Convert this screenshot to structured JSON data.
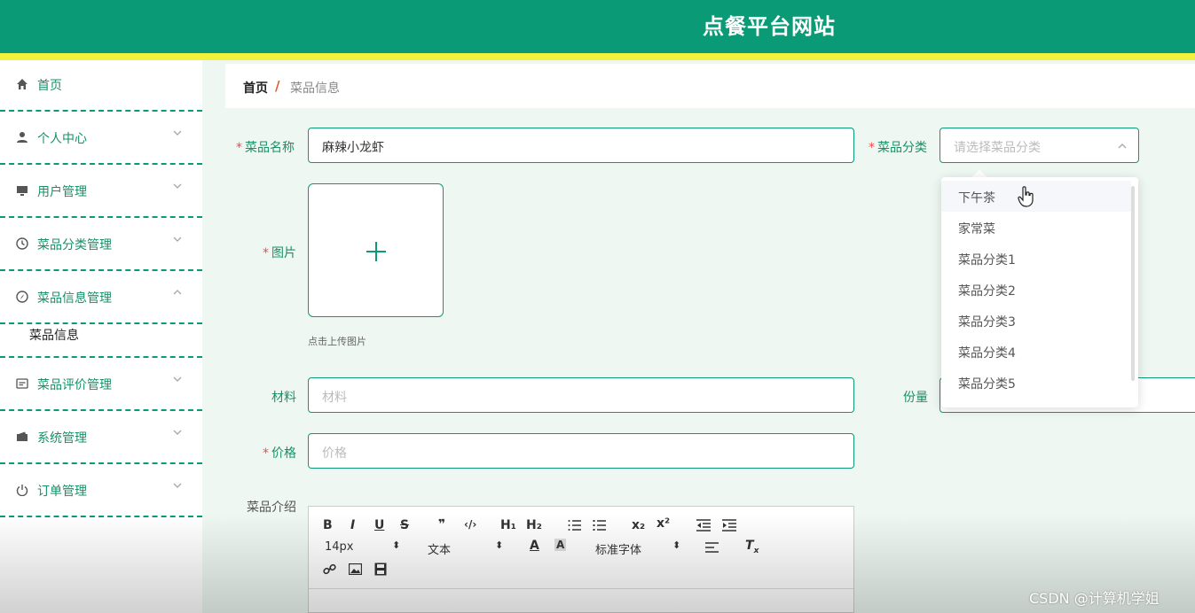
{
  "header": {
    "title": "点餐平台网站"
  },
  "sidebar": {
    "items": [
      {
        "label": "首页",
        "icon": "home-icon"
      },
      {
        "label": "个人中心",
        "icon": "user-icon"
      },
      {
        "label": "用户管理",
        "icon": "monitor-icon"
      },
      {
        "label": "菜品分类管理",
        "icon": "clock-icon"
      },
      {
        "label": "菜品信息管理",
        "icon": "compass-icon"
      },
      {
        "label": "菜品评价管理",
        "icon": "comment-icon"
      },
      {
        "label": "系统管理",
        "icon": "wallet-icon"
      },
      {
        "label": "订单管理",
        "icon": "power-icon"
      }
    ],
    "submenu": {
      "label": "菜品信息"
    }
  },
  "breadcrumb": {
    "home": "首页",
    "separator": "/",
    "current": "菜品信息"
  },
  "form": {
    "name": {
      "label": "菜品名称",
      "value": "麻辣小龙虾"
    },
    "category": {
      "label": "菜品分类",
      "placeholder": "请选择菜品分类"
    },
    "image": {
      "label": "图片",
      "hint": "点击上传图片"
    },
    "material": {
      "label": "材料",
      "placeholder": "材料"
    },
    "portion": {
      "label": "份量"
    },
    "price": {
      "label": "价格",
      "placeholder": "价格"
    },
    "intro": {
      "label": "菜品介绍"
    },
    "required_mark": "*"
  },
  "dropdown": {
    "options": [
      "下午茶",
      "家常菜",
      "菜品分类1",
      "菜品分类2",
      "菜品分类3",
      "菜品分类4",
      "菜品分类5"
    ],
    "hover_index": 0
  },
  "editor": {
    "font_size": "14px",
    "block_type": "文本",
    "font_family": "标准字体"
  },
  "watermark": "CSDN @计算机学姐",
  "colors": {
    "primary": "#0a9a76",
    "accent_strip": "#f2f23c",
    "required": "#ee4c4c"
  }
}
